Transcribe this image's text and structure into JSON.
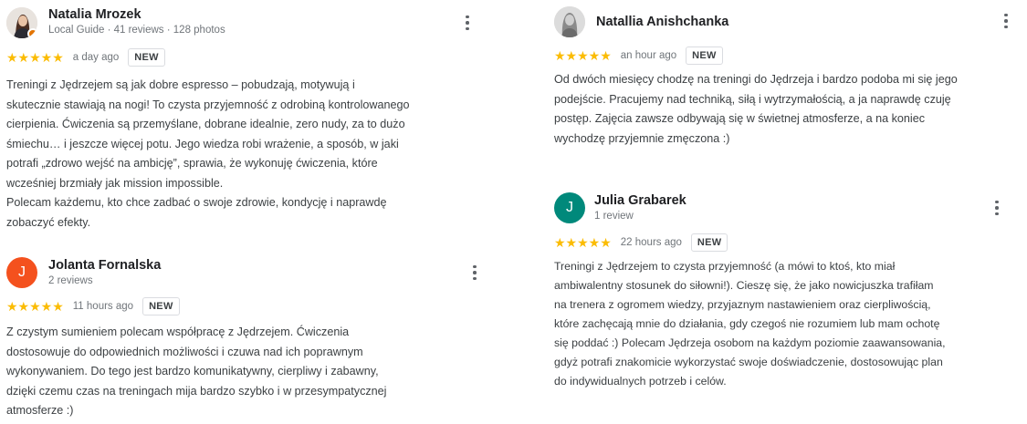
{
  "reviews": [
    {
      "name": "Natalia Mrozek",
      "meta": "Local Guide · 41 reviews · 128 photos",
      "stars": "★★★★★",
      "time": "a day ago",
      "badge": "NEW",
      "lines": [
        "Treningi z Jędrzejem są jak dobre espresso – pobudzają, motywują i",
        "skutecznie stawiają na nogi! To czysta przyjemność z odrobiną kontrolowanego",
        "cierpienia. Ćwiczenia są przemyślane, dobrane idealnie, zero nudy, za to dużo",
        "śmiechu… i jeszcze więcej potu. Jego wiedza robi wrażenie, a sposób, w jaki",
        "potrafi „zdrowo wejść na ambicję”, sprawia, że wykonuję ćwiczenia, które",
        "wcześniej brzmiały jak mission impossible.",
        "Polecam każdemu, kto chce zadbać o swoje zdrowie, kondycję i naprawdę",
        "zobaczyć efekty."
      ]
    },
    {
      "name": "Jolanta Fornalska",
      "initial": "J",
      "meta": "2 reviews",
      "stars": "★★★★★",
      "time": "11 hours ago",
      "badge": "NEW",
      "avatar_color": "#f4511e",
      "lines": [
        "Z czystym sumieniem polecam współpracę z Jędrzejem. Ćwiczenia",
        "dostosowuje do odpowiednich możliwości i czuwa nad ich poprawnym",
        "wykonywaniem. Do tego jest bardzo komunikatywny, cierpliwy i zabawny,",
        "dzięki czemu czas na treningach mija bardzo szybko i w przesympatycznej",
        "atmosferze :)"
      ]
    },
    {
      "name": "Natallia Anishchanka",
      "stars": "★★★★★",
      "time": "an hour ago",
      "badge": "NEW",
      "lines": [
        "Od dwóch miesięcy chodzę na treningi do Jędrzeja i bardzo podoba mi się jego",
        "podejście. Pracujemy nad techniką, siłą i wytrzymałością, a ja naprawdę czuję",
        "postęp. Zajęcia zawsze odbywają się w świetnej atmosferze, a na koniec",
        "wychodzę przyjemnie zmęczona :)"
      ]
    },
    {
      "name": "Julia Grabarek",
      "initial": "J",
      "meta": "1 review",
      "stars": "★★★★★",
      "time": "22 hours ago",
      "badge": "NEW",
      "avatar_color": "#00897b",
      "lines": [
        "Treningi z Jędrzejem to czysta przyjemność (a mówi to ktoś, kto miał",
        "ambiwalentny stosunek do siłowni!). Cieszę się, że jako nowicjuszka trafiłam",
        "na trenera z ogromem wiedzy, przyjaznym nastawieniem oraz cierpliwością,",
        "które zachęcają mnie do działania, gdy czegoś nie rozumiem lub mam ochotę",
        "się poddać :) Polecam Jędrzeja osobom na każdym poziomie zaawansowania,",
        "gdyż potrafi znakomicie wykorzystać swoje doświadczenie, dostosowując plan",
        "do indywidualnych potrzeb i celów."
      ]
    }
  ]
}
